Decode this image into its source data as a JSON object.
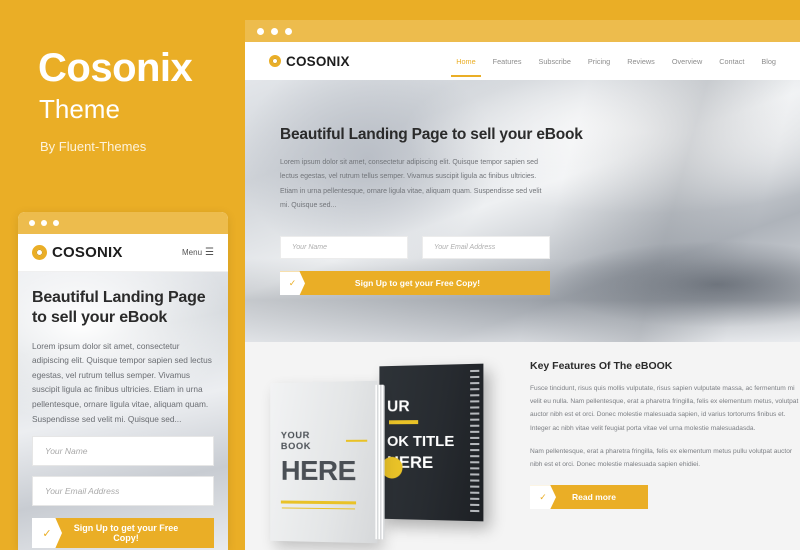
{
  "brand": {
    "title": "Cosonix",
    "subtitle": "Theme",
    "author": "By Fluent-Themes",
    "bg_color": "#eaae26",
    "accent_color": "#eaae26"
  },
  "logo": {
    "text": "COSONIX",
    "mark": "ring-o-icon"
  },
  "desktop": {
    "titlebar_dots": [
      "dot",
      "dot",
      "dot"
    ],
    "nav": [
      {
        "label": "Home",
        "active": true
      },
      {
        "label": "Features",
        "active": false
      },
      {
        "label": "Subscribe",
        "active": false
      },
      {
        "label": "Pricing",
        "active": false
      },
      {
        "label": "Reviews",
        "active": false
      },
      {
        "label": "Overview",
        "active": false
      },
      {
        "label": "Contact",
        "active": false
      },
      {
        "label": "Blog",
        "active": false
      }
    ],
    "hero": {
      "heading": "Beautiful Landing Page to sell your eBook",
      "paragraph": "Lorem ipsum dolor sit amet, consectetur adipiscing elit. Quisque tempor sapien sed lectus egestas, vel rutrum tellus semper. Vivamus suscipit ligula ac finibus ultricies. Etiam in urna pellentesque, ornare ligula vitae, aliquam quam. Suspendisse sed velit mi. Quisque sed...",
      "name_placeholder": "Your Name",
      "email_placeholder": "Your Email Address",
      "cta_label": "Sign Up to get your Free Copy!",
      "cta_icon": "check-icon"
    },
    "features": {
      "title": "Key Features Of The eBOOK",
      "paragraph1": "Fusce tincidunt, risus quis mollis vulputate, risus sapien vulputate massa, ac fermentum mi velit eu nulla. Nam pellentesque, erat a pharetra fringilla, felis ex elementum metus, volutpat auctor nibh est et orci. Donec molestie malesuada sapien, id varius tortorums finibus et. Integer ac nibh vitae velit feugiat porta vitae vel urna molestie malesuadasda.",
      "paragraph2": "Nam pellentesque, erat a pharetra fringilla, felis ex elementum metus pullu volutpat auctor nibh est et orci. Donec molestie malesuada sapien ehidiei.",
      "button_label": "Read more",
      "button_icon": "check-icon"
    },
    "books": {
      "light": {
        "line1": "YOUR BOOK",
        "line2": "HERE"
      },
      "dark": {
        "line1": "UR",
        "line2": "OK TITLE",
        "line3": "HERE"
      }
    }
  },
  "mobile": {
    "titlebar_dots": [
      "dot",
      "dot",
      "dot"
    ],
    "menu_label": "Menu",
    "menu_icon": "hamburger-icon",
    "heading": "Beautiful Landing Page to sell your eBook",
    "paragraph": "Lorem ipsum dolor sit amet, consectetur adipiscing elit. Quisque tempor sapien sed lectus egestas, vel rutrum tellus semper. Vivamus suscipit ligula ac finibus ultricies. Etiam in urna pellentesque, ornare ligula vitae, aliquam quam. Suspendisse sed velit mi. Quisque sed...",
    "name_placeholder": "Your Name",
    "email_placeholder": "Your Email Address",
    "cta_label": "Sign Up to get your Free Copy!",
    "cta_icon": "check-icon"
  }
}
